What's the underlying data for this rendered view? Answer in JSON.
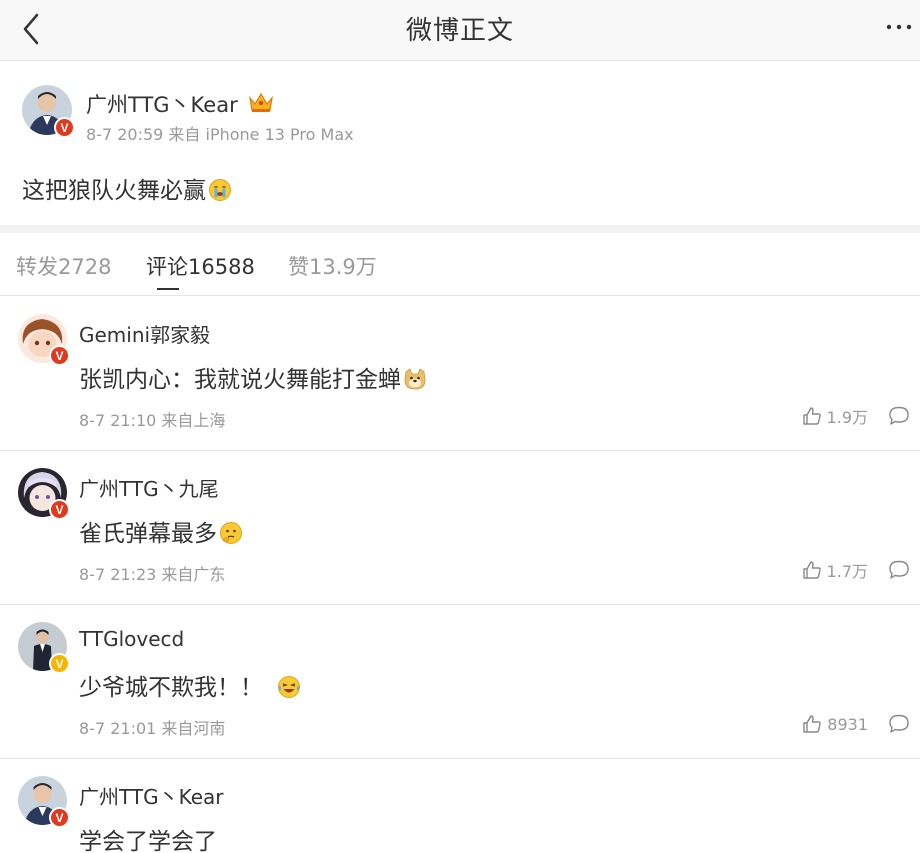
{
  "header": {
    "title": "微博正文"
  },
  "post": {
    "author": "广州TTG丶Kear",
    "meta": "8-7 20:59 来自 iPhone 13 Pro Max",
    "text": "这把狼队火舞必赢"
  },
  "tabs": [
    {
      "label": "转发2728"
    },
    {
      "label": "评论16588"
    },
    {
      "label": "赞13.9万"
    }
  ],
  "comments": [
    {
      "name": "Gemini郭家毅",
      "text": "张凯内心：我就说火舞能打金蝉",
      "meta": "8-7 21:10 来自上海",
      "likes": "1.9万",
      "badge": "red"
    },
    {
      "name": "广州TTG丶九尾",
      "text": "雀氏弹幕最多",
      "meta": "8-7 21:23 来自广东",
      "likes": "1.7万",
      "badge": "red"
    },
    {
      "name": "TTGlovecd",
      "text": "少爷城不欺我！！",
      "meta": "8-7 21:01 来自河南",
      "likes": "8931",
      "badge": "yellow"
    },
    {
      "name": "广州TTG丶Kear",
      "text": "学会了学会了",
      "meta": "",
      "likes": "",
      "badge": "red"
    }
  ],
  "colors": {
    "badge_red": "#e03a1e",
    "badge_yellow": "#f7b500",
    "muted": "#999999"
  }
}
